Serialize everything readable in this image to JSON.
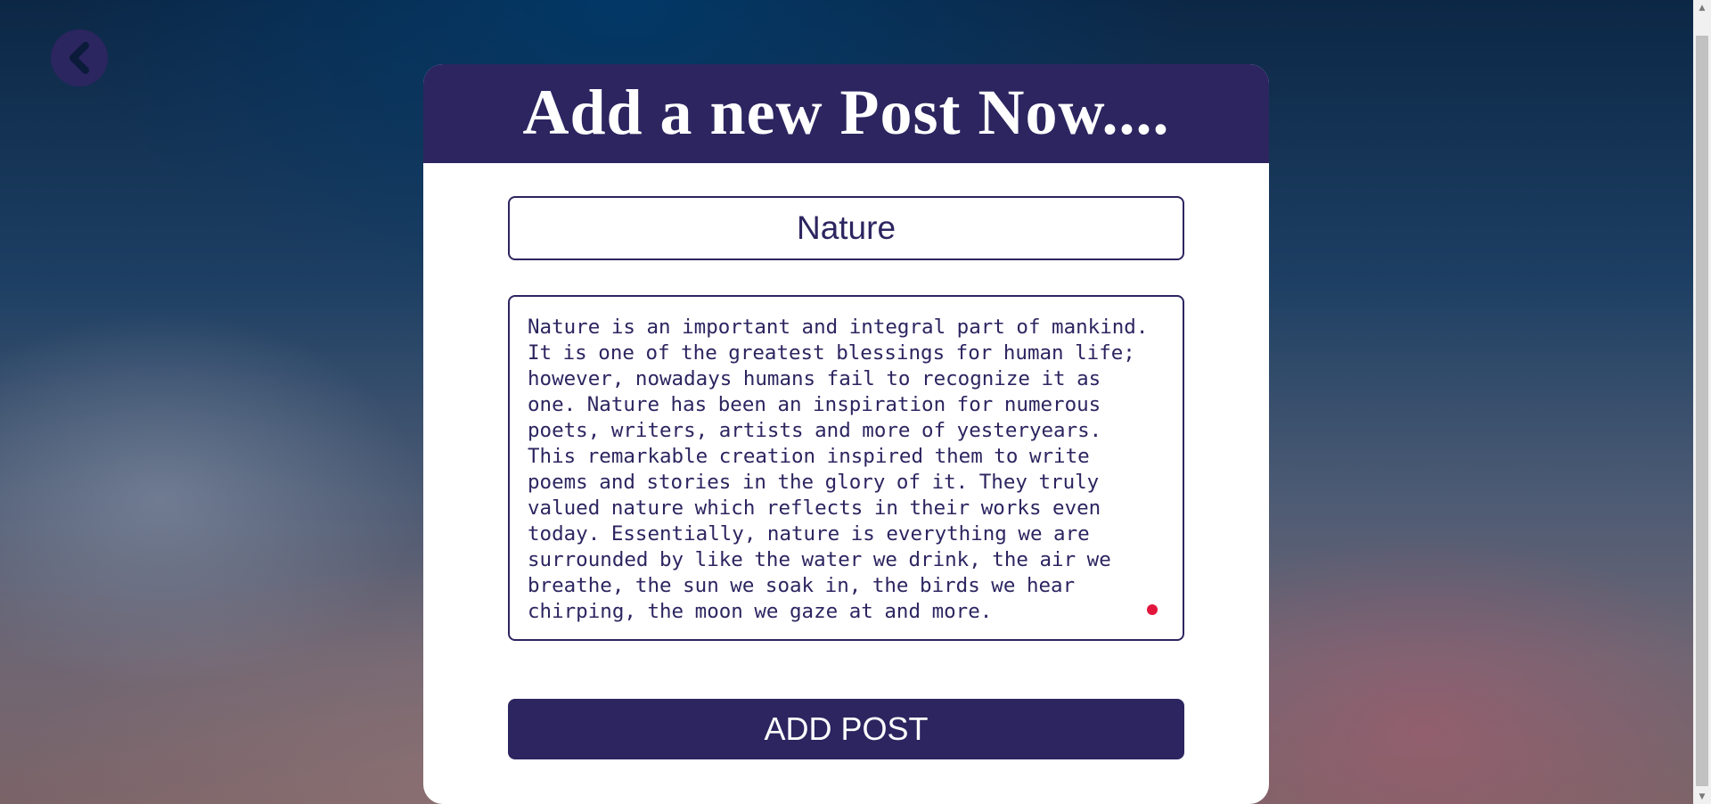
{
  "back_button": {
    "icon": "chevron-left-icon"
  },
  "form": {
    "heading": "Add a new Post Now....",
    "title_value": "Nature",
    "body_lines": [
      "Nature is an important and integral part of mankind.",
      "It is one of the greatest blessings for human life;",
      "however, nowadays humans fail to recognize it as",
      "one. Nature has been an inspiration for numerous",
      "poets, writers, artists and more of yesteryears.",
      "This remarkable creation inspired them to write",
      "poems and stories in the glory of it. They truly",
      "valued nature which reflects in their works even",
      "today. Essentially, nature is everything we are",
      "surrounded by like the water we drink, the air we",
      "breathe, the sun we soak in, the birds we hear",
      "chirping, the moon we gaze at and more."
    ],
    "submit_label": "ADD POST"
  },
  "scrollbar": {
    "up_glyph": "▲",
    "down_glyph": "▼"
  },
  "colors": {
    "primary": "#2c2560",
    "resize_dot": "#e2163c"
  }
}
